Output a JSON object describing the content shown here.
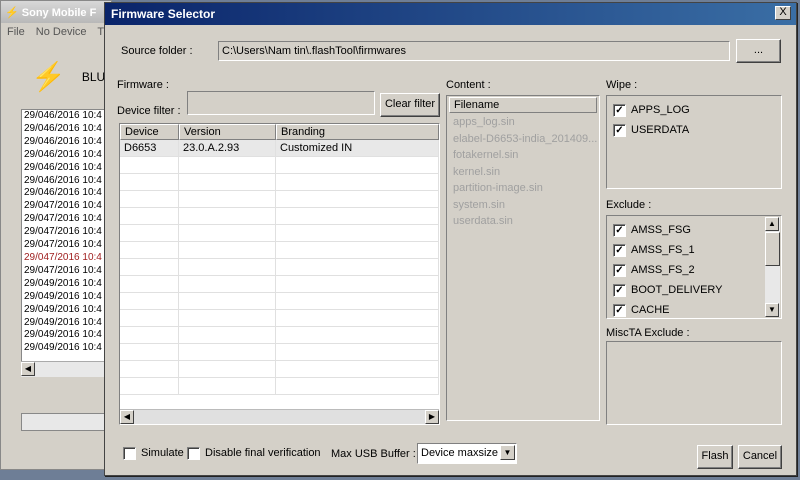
{
  "bg_window": {
    "title": "Sony Mobile F",
    "menu": [
      "File",
      "No Device",
      "T"
    ],
    "bolt": "⚡",
    "device": "BLU",
    "log": [
      "29/046/2016 10:4",
      "29/046/2016 10:4",
      "29/046/2016 10:4",
      "29/046/2016 10:4",
      "29/046/2016 10:4",
      "29/046/2016 10:4",
      "29/046/2016 10:4",
      "29/047/2016 10:4",
      "29/047/2016 10:4",
      "29/047/2016 10:4",
      "29/047/2016 10:4",
      "29/047/2016 10:4",
      "29/047/2016 10:4",
      "29/049/2016 10:4",
      "29/049/2016 10:4",
      "29/049/2016 10:4",
      "29/049/2016 10:4",
      "29/049/2016 10:4",
      "29/049/2016 10:4"
    ],
    "log_highlight_index": 11
  },
  "dialog": {
    "title": "Firmware Selector",
    "close_label": "X",
    "source_folder_label": "Source folder :",
    "source_folder_value": "C:\\Users\\Nam tin\\.flashTool\\firmwares",
    "browse_label": "...",
    "firmware_label": "Firmware :",
    "device_filter_label": "Device filter :",
    "device_filter_value": "",
    "clear_filter_label": "Clear filter",
    "table": {
      "headers": [
        "Device",
        "Version",
        "Branding"
      ],
      "rows": [
        [
          "D6653",
          "23.0.A.2.93",
          "Customized IN"
        ]
      ]
    },
    "content_label": "Content :",
    "content_header": "Filename",
    "content_items": [
      "apps_log.sin",
      "elabel-D6653-india_201409...",
      "fotakernel.sin",
      "kernel.sin",
      "partition-image.sin",
      "system.sin",
      "userdata.sin"
    ],
    "wipe_label": "Wipe :",
    "wipe_items": [
      "APPS_LOG",
      "USERDATA"
    ],
    "exclude_label": "Exclude :",
    "exclude_items": [
      "AMSS_FSG",
      "AMSS_FS_1",
      "AMSS_FS_2",
      "BOOT_DELIVERY",
      "CACHE"
    ],
    "miscta_label": "MiscTA Exclude :",
    "simulate_label": "Simulate",
    "disable_verify_label": "Disable final verification",
    "usb_buffer_label": "Max USB Buffer :",
    "usb_buffer_value": "Device maxsize",
    "flash_label": "Flash",
    "cancel_label": "Cancel"
  }
}
